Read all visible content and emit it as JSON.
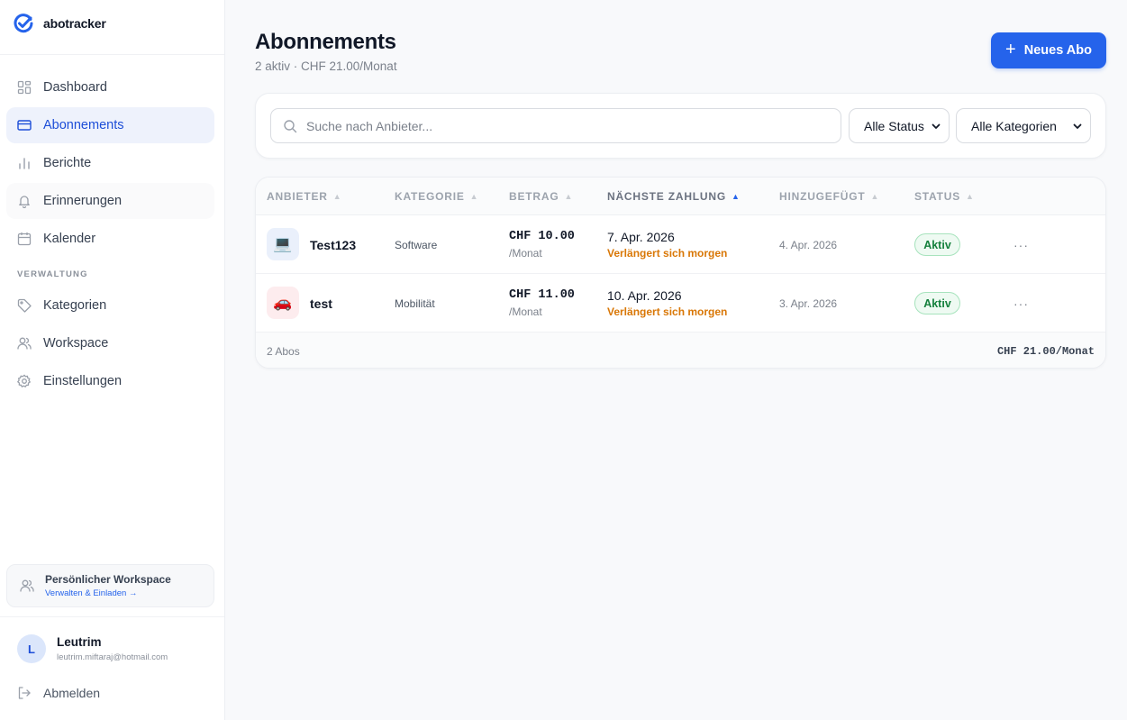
{
  "app": {
    "name": "abotracker",
    "accent": "#2563eb"
  },
  "sidebar": {
    "items": [
      {
        "label": "Dashboard",
        "icon": "dashboard-icon",
        "active": false
      },
      {
        "label": "Abonnements",
        "icon": "credit-card-icon",
        "active": true
      },
      {
        "label": "Berichte",
        "icon": "bar-chart-icon",
        "active": false
      },
      {
        "label": "Erinnerungen",
        "icon": "bell-icon",
        "active": false
      },
      {
        "label": "Kalender",
        "icon": "calendar-icon",
        "active": false
      }
    ],
    "section_label": "VERWALTUNG",
    "admin_items": [
      {
        "label": "Kategorien",
        "icon": "tag-icon"
      },
      {
        "label": "Workspace",
        "icon": "users-icon"
      },
      {
        "label": "Einstellungen",
        "icon": "gear-icon"
      }
    ],
    "workspace": {
      "title": "Persönlicher Workspace",
      "link": "Verwalten & Einladen →"
    },
    "user": {
      "initial": "L",
      "name": "Leutrim",
      "email": "leutrim.miftaraj@hotmail.com"
    },
    "logout_label": "Abmelden"
  },
  "header": {
    "title": "Abonnements",
    "subtitle": "2 aktiv · CHF 21.00/Monat",
    "new_button": "Neues Abo"
  },
  "filters": {
    "search_placeholder": "Suche nach Anbieter...",
    "search_value": "",
    "status_selected": "Alle Status",
    "category_selected": "Alle Kategorien"
  },
  "table": {
    "columns": [
      "ANBIETER",
      "KATEGORIE",
      "BETRAG",
      "NÄCHSTE ZAHLUNG",
      "HINZUGEFÜGT",
      "STATUS"
    ],
    "sorted_column": "NÄCHSTE ZAHLUNG",
    "rows": [
      {
        "provider": "Test123",
        "icon": "laptop-icon",
        "emoji": "💻",
        "icon_bg": "#eaf0fb",
        "category": "Software",
        "amount": "CHF 10.00",
        "period": "/Monat",
        "next_date": "7. Apr. 2026",
        "renew_note": "Verlängert sich morgen",
        "added": "4. Apr. 2026",
        "status": "Aktiv"
      },
      {
        "provider": "test",
        "icon": "car-icon",
        "emoji": "🚗",
        "icon_bg": "#fdecee",
        "category": "Mobilität",
        "amount": "CHF 11.00",
        "period": "/Monat",
        "next_date": "10. Apr. 2026",
        "renew_note": "Verlängert sich morgen",
        "added": "3. Apr. 2026",
        "status": "Aktiv"
      }
    ],
    "footer_count": "2 Abos",
    "footer_total": "CHF 21.00/Monat"
  }
}
